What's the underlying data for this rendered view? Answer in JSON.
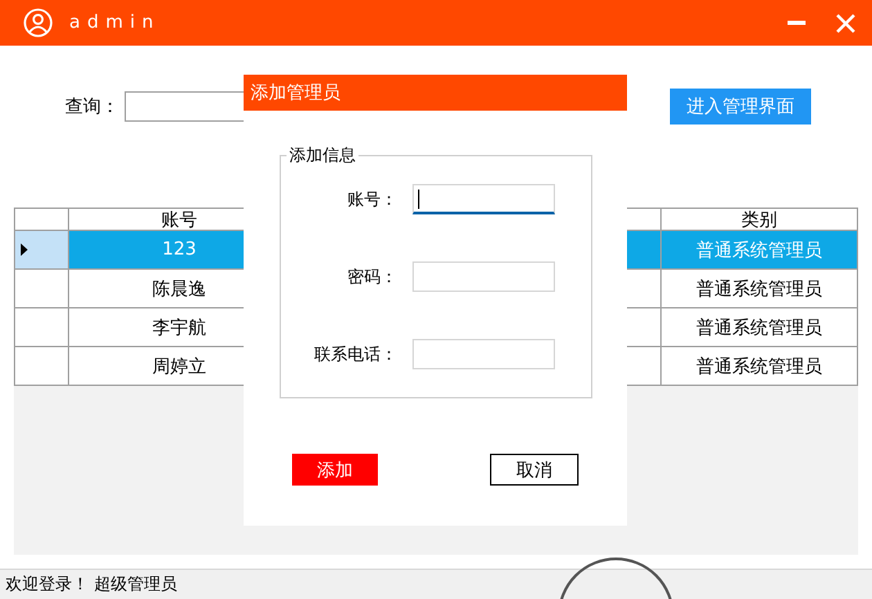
{
  "window": {
    "title": "admin"
  },
  "search": {
    "label": "查询："
  },
  "manage_button": "进入管理界面",
  "table": {
    "columns": [
      "账号",
      "类别"
    ],
    "rows": [
      {
        "cells": [
          "123",
          "普通系统管理员"
        ],
        "selected": true
      },
      {
        "cells": [
          "陈晨逸",
          "普通系统管理员"
        ],
        "selected": false
      },
      {
        "cells": [
          "李宇航",
          "普通系统管理员"
        ],
        "selected": false
      },
      {
        "cells": [
          "周婷立",
          "普通系统管理员"
        ],
        "selected": false
      }
    ]
  },
  "dialog": {
    "title": "添加管理员",
    "group_title": "添加信息",
    "fields": [
      {
        "label": "账号：",
        "focused": true
      },
      {
        "label": "密码：",
        "focused": false
      },
      {
        "label": "联系电话：",
        "focused": false
      }
    ],
    "buttons": [
      {
        "label": "添加",
        "kind": "primary"
      },
      {
        "label": "取消",
        "kind": "secondary"
      }
    ]
  },
  "status_bar": {
    "text": "欢迎登录！ 超级管理员"
  }
}
